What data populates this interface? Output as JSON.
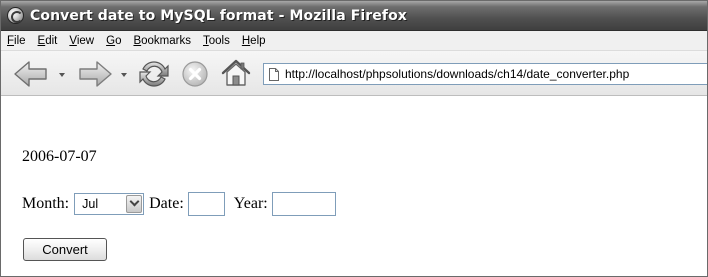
{
  "window": {
    "title": "Convert date to MySQL format - Mozilla Firefox"
  },
  "menu": {
    "items": [
      {
        "label": "File",
        "underline": "F",
        "rest": "ile"
      },
      {
        "label": "Edit",
        "underline": "E",
        "rest": "dit"
      },
      {
        "label": "View",
        "underline": "V",
        "rest": "iew"
      },
      {
        "label": "Go",
        "underline": "G",
        "rest": "o"
      },
      {
        "label": "Bookmarks",
        "underline": "B",
        "rest": "ookmarks"
      },
      {
        "label": "Tools",
        "underline": "T",
        "rest": "ools"
      },
      {
        "label": "Help",
        "underline": "H",
        "rest": "elp"
      }
    ]
  },
  "toolbar": {
    "url": "http://localhost/phpsolutions/downloads/ch14/date_converter.php",
    "icons": [
      "back-icon",
      "forward-icon",
      "reload-icon",
      "stop-icon",
      "home-icon",
      "page-icon"
    ]
  },
  "page": {
    "result_text": "2006-07-07",
    "month_label": "Month:",
    "month_selected": "Jul",
    "date_label": "Date:",
    "date_value": "",
    "year_label": "Year:",
    "year_value": "",
    "convert_label": "Convert"
  }
}
